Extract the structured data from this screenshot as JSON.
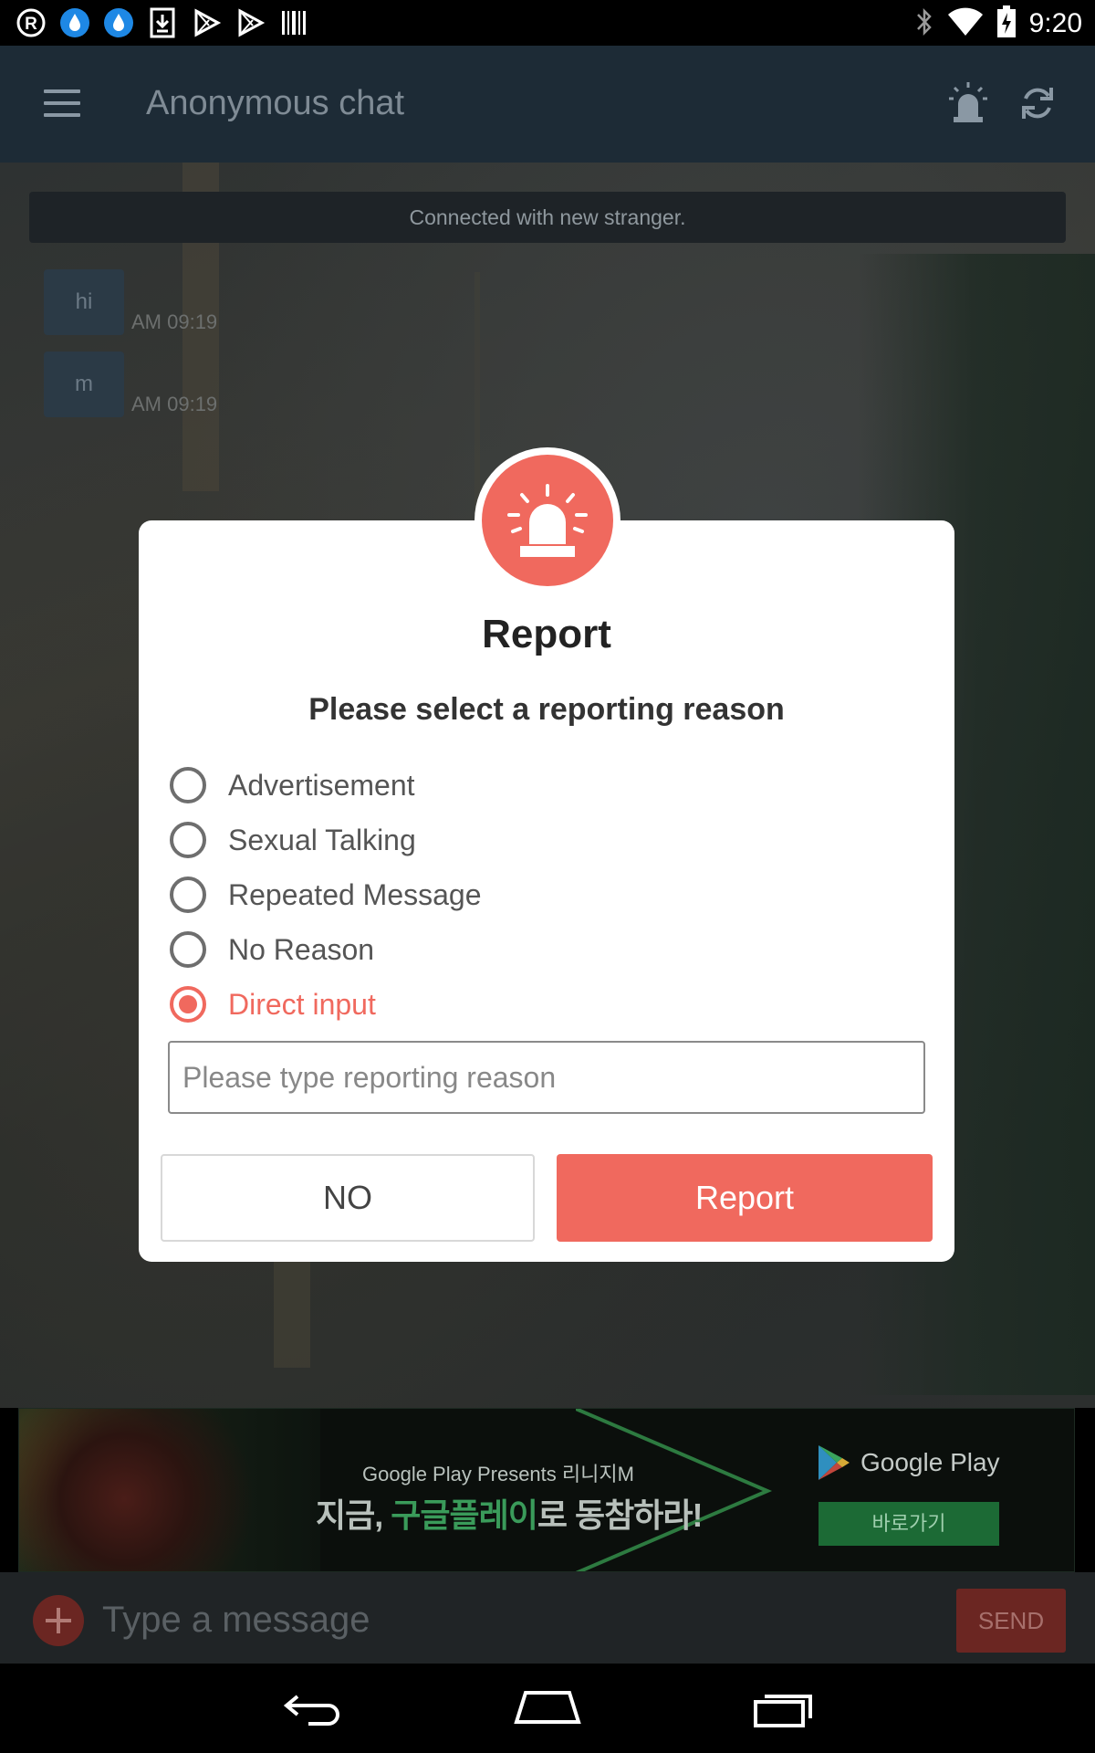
{
  "status_bar": {
    "time": "9:20",
    "left_icons": [
      "registered-icon",
      "drop-icon",
      "drop-icon",
      "download-icon",
      "play-store-icon",
      "play-store-icon",
      "barcode-icon"
    ],
    "right_icons": [
      "bluetooth-icon",
      "wifi-icon",
      "battery-charging-icon"
    ]
  },
  "app_bar": {
    "title": "Anonymous chat",
    "icons": [
      "menu-icon",
      "alarm-bell-icon",
      "refresh-icon"
    ]
  },
  "chat": {
    "system_message": "Connected with new stranger.",
    "messages": [
      {
        "text": "hi",
        "time": "AM 09:19"
      },
      {
        "text": "m",
        "time": "AM 09:19"
      }
    ]
  },
  "ad": {
    "subtitle": "Google Play Presents 리니지M",
    "headline_pre": "지금, ",
    "headline_highlight": "구글플레이",
    "headline_post": "로 동참하라!",
    "store_name": "Google Play",
    "cta": "바로가기"
  },
  "input_bar": {
    "placeholder": "Type a message",
    "send_label": "SEND"
  },
  "dialog": {
    "title": "Report",
    "subtitle": "Please select a reporting reason",
    "options": [
      {
        "label": "Advertisement",
        "checked": false
      },
      {
        "label": "Sexual Talking",
        "checked": false
      },
      {
        "label": "Repeated Message",
        "checked": false
      },
      {
        "label": "No Reason",
        "checked": false
      },
      {
        "label": "Direct input",
        "checked": true
      }
    ],
    "input_placeholder": "Please type reporting reason",
    "no_label": "NO",
    "report_label": "Report"
  },
  "colors": {
    "accent": "#f0695e",
    "app_bar": "#1d2b36",
    "dialog_bg": "#ffffff"
  }
}
